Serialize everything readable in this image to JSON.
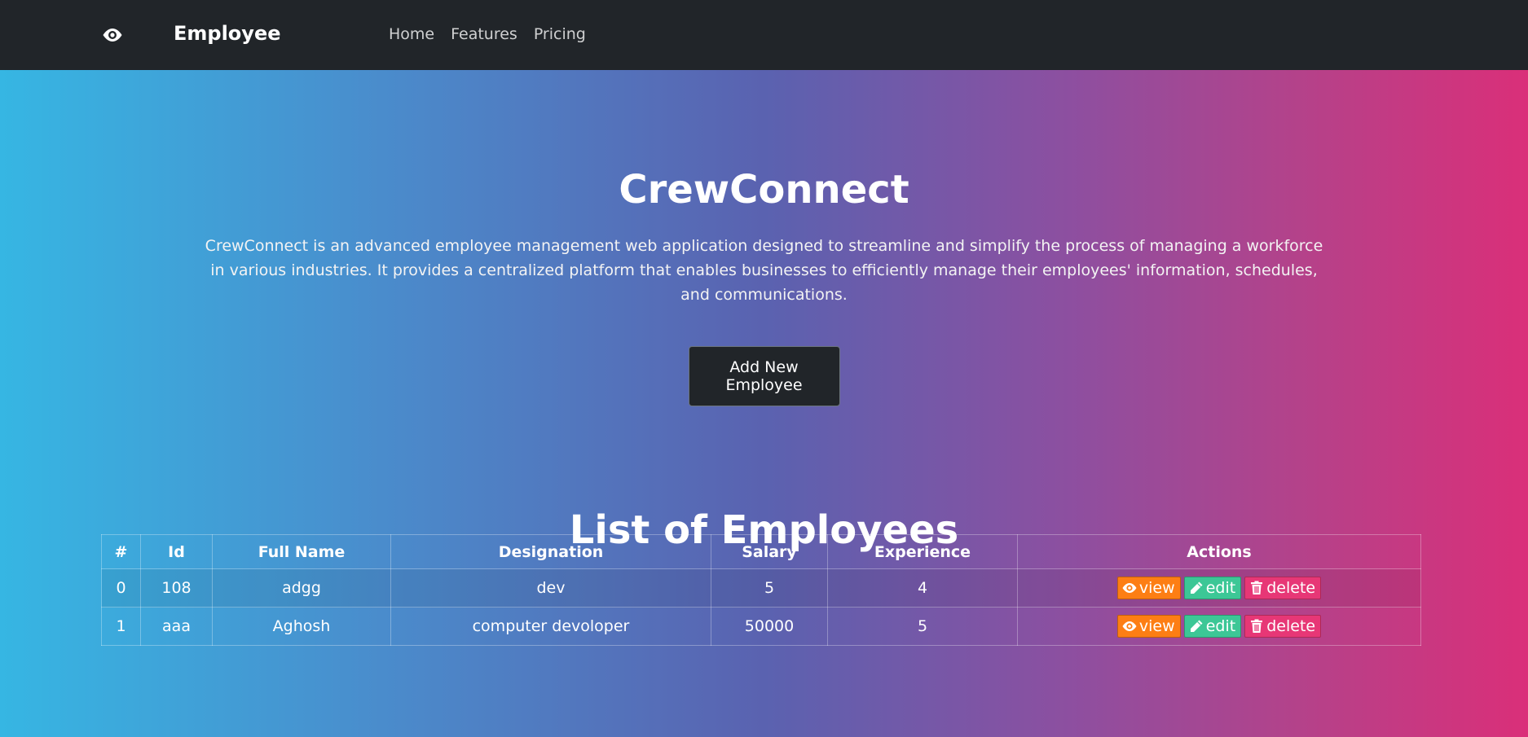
{
  "navbar": {
    "brand": "Employee",
    "logo_icon": "eye-icon",
    "links": [
      "Home",
      "Features",
      "Pricing"
    ]
  },
  "hero": {
    "title": "CrewConnect",
    "description": "CrewConnect is an advanced employee management web application designed to streamline and simplify the process of managing a workforce in various industries. It provides a centralized platform that enables businesses to efficiently manage their employees' information, schedules, and communications.",
    "add_button": "Add New Employee"
  },
  "list": {
    "title": "List of Employees",
    "columns": [
      "#",
      "Id",
      "Full Name",
      "Designation",
      "Salary",
      "Experience",
      "Actions"
    ],
    "rows": [
      [
        "0",
        "108",
        "adgg",
        "dev",
        "5",
        "4"
      ],
      [
        "1",
        "aaa",
        "Aghosh",
        "computer devoloper",
        "50000",
        "5"
      ]
    ],
    "actions": {
      "view": "view",
      "edit": "edit",
      "delete": "delete"
    }
  },
  "colors": {
    "navbar_bg": "#212529",
    "view": "#fd7e14",
    "edit": "#3cc796",
    "delete": "#e73776",
    "gradient_start": "#36b6e3",
    "gradient_end": "#da2f79"
  }
}
